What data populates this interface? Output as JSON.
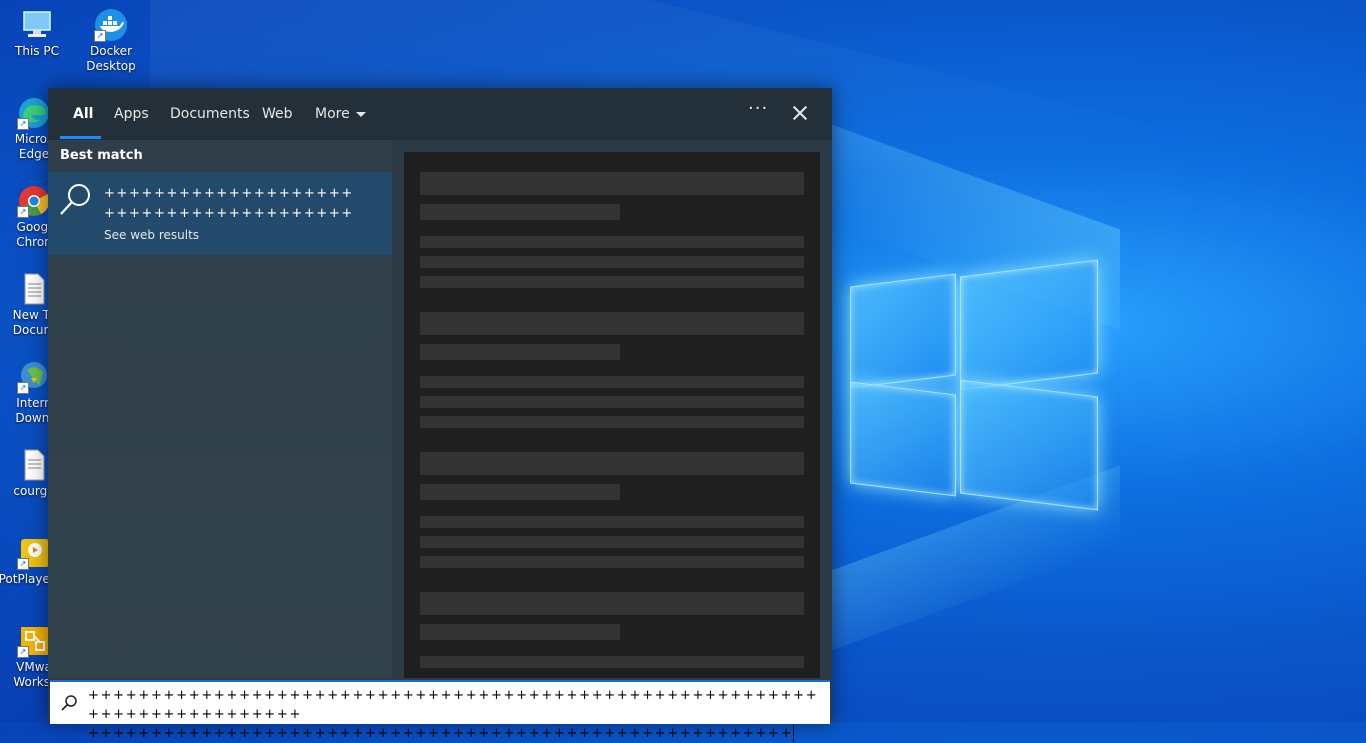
{
  "desktop": {
    "icons": [
      {
        "label": "This PC",
        "icon": "computer-icon"
      },
      {
        "label": "Docker Desktop",
        "icon": "docker-icon"
      },
      {
        "label": "Micros Edge",
        "icon": "edge-icon"
      },
      {
        "label": "Googl Chron",
        "icon": "chrome-icon"
      },
      {
        "label": "New Te Docum",
        "icon": "text-file-icon"
      },
      {
        "label": "Intern Downl",
        "icon": "idm-icon"
      },
      {
        "label": "courge",
        "icon": "text-file-icon"
      },
      {
        "label": "PotPlaye bit",
        "icon": "potplayer-icon"
      },
      {
        "label": "VMwa Workst",
        "icon": "vmware-icon"
      }
    ]
  },
  "search": {
    "tabs": [
      "All",
      "Apps",
      "Documents",
      "Web",
      "More"
    ],
    "active_tab": "All",
    "accent_color": "#1a8cff",
    "best_match_heading": "Best match",
    "best_match": {
      "query_line1": "++++++++++++++++++++",
      "query_line2": "++++++++++++++++++++",
      "subtitle": "See web results"
    },
    "input_line1": "+++++++++++++++++++++++++++++++++++++++++++++++++++++++++++++++++++++++++++",
    "input_line2": "++++++++++++++++++++++++++++++++++++++++++++++++++++++++"
  }
}
